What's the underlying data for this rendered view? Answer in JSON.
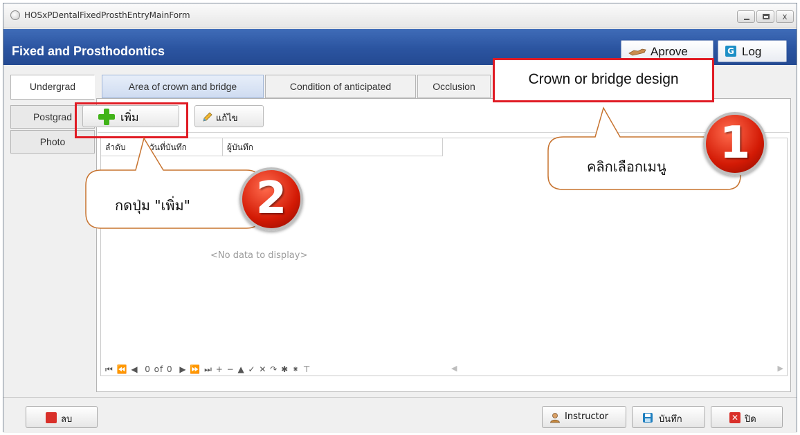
{
  "window": {
    "title": "HOSxPDentalFixedProsthEntryMainForm",
    "controls": {
      "close": "x"
    }
  },
  "header": {
    "title": "Fixed and Prosthodontics",
    "approve_label": "Aprove",
    "log_label": "Log",
    "log_icon_glyph": "G"
  },
  "left_tabs": [
    {
      "label": "Undergrad",
      "active": true
    },
    {
      "label": "Postgrad",
      "active": false
    },
    {
      "label": "Photo",
      "active": false
    }
  ],
  "top_tabs": [
    {
      "label": "Area of crown and bridge",
      "active": true
    },
    {
      "label": "Condition of anticipated",
      "active": false
    },
    {
      "label": "Occlusion",
      "active": false
    },
    {
      "label": "Crown or bridge design",
      "active": false
    }
  ],
  "toolbar": {
    "add_label": "เพิ่ม",
    "edit_label": "แก้ไข"
  },
  "grid": {
    "columns": [
      "ลำดับ",
      "วันที่บันทึก",
      "ผู้บันทึก"
    ],
    "empty_text": "<No data to display>",
    "navigator": "⏮ ⏪ ◀  0 of 0  ▶ ⏩ ⏭ + − ▲ ✓ ✕ ↷ ✱ ⁕ ⊤",
    "scroll_left": "◀",
    "scroll_right": "▶"
  },
  "bottom": {
    "delete_label": "ลบ",
    "instructor_label": "Instructor",
    "save_label": "บันทึก",
    "close_label": "ปิด"
  },
  "annotations": {
    "step1_text": "คลิกเลือกเมนู",
    "step1_number": "1",
    "step2_text": "กดปุ่ม \"เพิ่ม\"",
    "step2_number": "2"
  },
  "colors": {
    "header_blue": "#2b54a0",
    "highlight_red": "#e01b24",
    "add_green": "#41b319"
  }
}
